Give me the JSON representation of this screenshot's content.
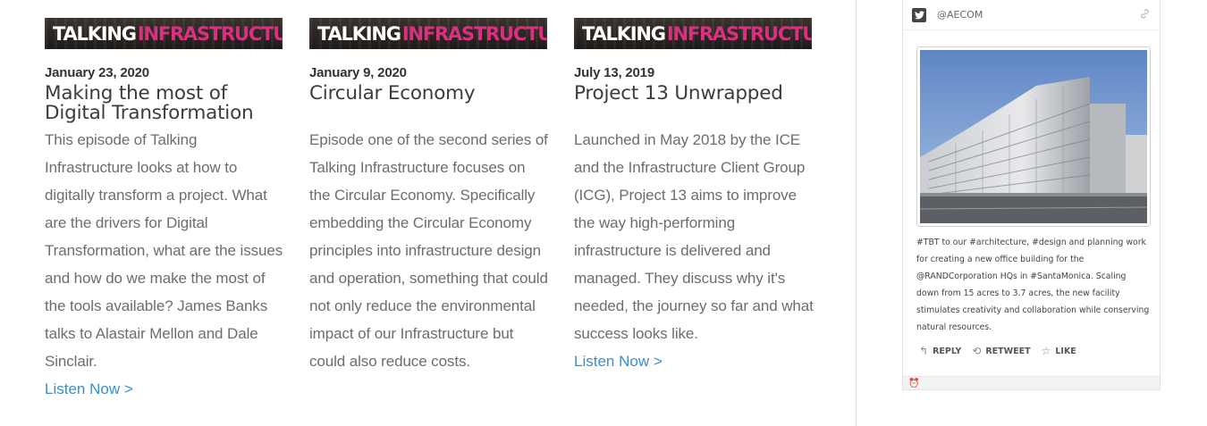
{
  "articles": [
    {
      "banner_talking": "TALKING",
      "banner_infra": "INFRASTRUCTURE",
      "date": "January 23, 2020",
      "title": "Making the most of Digital Transformation",
      "description": "This episode of Talking Infrastructure looks at how to digitally transform a project. What are the drivers for Digital Transformation, what are the issues and how do we make the most of the tools available? James Banks talks to Alastair Mellon and Dale Sinclair.",
      "link": "Listen Now >"
    },
    {
      "banner_talking": "TALKING",
      "banner_infra": "INFRASTRUCTURE",
      "date": "January 9, 2020",
      "title": "Circular Economy",
      "description": "Episode one of the second series of Talking Infrastructure focuses on the Circular Economy. Specifically embedding the Circular Economy principles into infrastructure design and operation, something that could not only reduce the environmental impact of our Infrastructure but could also reduce costs.",
      "link": ""
    },
    {
      "banner_talking": "TALKING",
      "banner_infra": "INFRASTRUCTURE",
      "date": "July 13, 2019",
      "title": "Project 13 Unwrapped",
      "description": "Launched in May 2018 by the ICE and the Infrastructure Client Group (ICG), Project 13 aims to improve the way high-performing infrastructure is delivered and managed. They discuss why it's needed, the journey so far and what success looks like.",
      "link": "Listen Now >"
    }
  ],
  "tweet": {
    "handle": "@AECOM",
    "text": "#TBT to our #architecture, #design and planning work for creating a new office building for the @RANDCorporation HQs in #SantaMonica. Scaling down from 15 acres to 3.7 acres, the new facility stimulates creativity and collaboration while conserving natural resources.",
    "actions": {
      "reply": "REPLY",
      "retweet": "RETWEET",
      "like": "LIKE"
    }
  },
  "colors": {
    "accent_pink": "#d9307f",
    "link_blue": "#3a8fc8"
  }
}
